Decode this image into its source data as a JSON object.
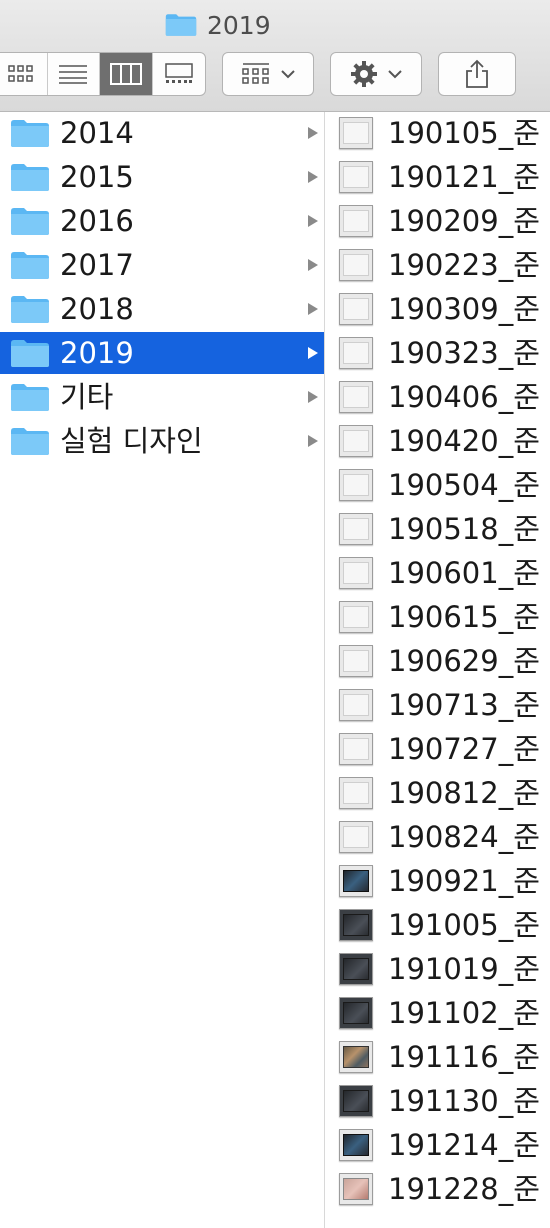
{
  "window": {
    "title": "2019"
  },
  "toolbar": {
    "view_modes": [
      {
        "name": "icon-view",
        "icon": "grid-icon"
      },
      {
        "name": "list-view",
        "icon": "list-icon"
      },
      {
        "name": "column-view",
        "icon": "columns-icon",
        "active": true
      },
      {
        "name": "gallery-view",
        "icon": "gallery-icon"
      }
    ],
    "group_icon": "arrange-icon",
    "action_icon": "gear-icon",
    "share_icon": "share-icon"
  },
  "colors": {
    "selection": "#1563df",
    "folder": "#5bb7f3"
  },
  "column1": {
    "items": [
      {
        "label": "2014"
      },
      {
        "label": "2015"
      },
      {
        "label": "2016"
      },
      {
        "label": "2017"
      },
      {
        "label": "2018"
      },
      {
        "label": "2019",
        "selected": true
      },
      {
        "label": "기타"
      },
      {
        "label": "실험 디자인"
      }
    ]
  },
  "column2": {
    "items": [
      {
        "label": "190105_준",
        "thumb": "light"
      },
      {
        "label": "190121_준",
        "thumb": "light"
      },
      {
        "label": "190209_준",
        "thumb": "light"
      },
      {
        "label": "190223_준",
        "thumb": "light"
      },
      {
        "label": "190309_준",
        "thumb": "light"
      },
      {
        "label": "190323_준",
        "thumb": "light"
      },
      {
        "label": "190406_준",
        "thumb": "light"
      },
      {
        "label": "190420_준",
        "thumb": "light"
      },
      {
        "label": "190504_준",
        "thumb": "light"
      },
      {
        "label": "190518_준",
        "thumb": "light"
      },
      {
        "label": "190601_준",
        "thumb": "light"
      },
      {
        "label": "190615_준",
        "thumb": "light"
      },
      {
        "label": "190629_준",
        "thumb": "light"
      },
      {
        "label": "190713_준",
        "thumb": "light"
      },
      {
        "label": "190727_준",
        "thumb": "light"
      },
      {
        "label": "190812_준",
        "thumb": "light"
      },
      {
        "label": "190824_준",
        "thumb": "light"
      },
      {
        "label": "190921_준",
        "thumb": "blue"
      },
      {
        "label": "191005_준",
        "thumb": "dark"
      },
      {
        "label": "191019_준",
        "thumb": "dark"
      },
      {
        "label": "191102_준",
        "thumb": "dark"
      },
      {
        "label": "191116_준",
        "thumb": "photo"
      },
      {
        "label": "191130_준",
        "thumb": "dark"
      },
      {
        "label": "191214_준",
        "thumb": "blue"
      },
      {
        "label": "191228_준",
        "thumb": "pink"
      }
    ]
  }
}
